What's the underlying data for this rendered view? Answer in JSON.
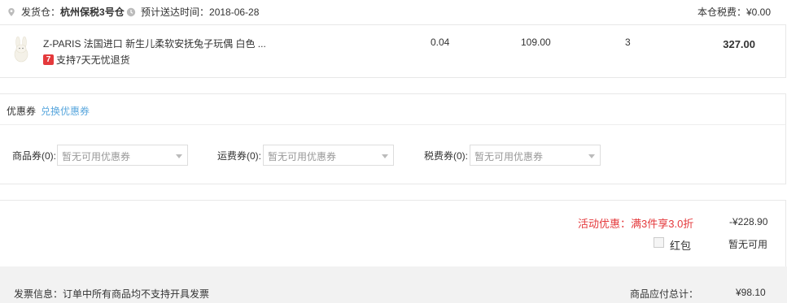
{
  "warehouse": {
    "label": "发货仓：",
    "name": "杭州保税3号仓",
    "eta_label": "预计送达时间：",
    "eta_date": "2018-06-28",
    "tax_label": "本仓税费：",
    "tax_value": "¥0.00"
  },
  "product": {
    "name": "Z-PARIS 法国进口 新生儿柔软安抚兔子玩偶 白色 ...",
    "tag_badge": "7",
    "tag_text": "支持7天无忧退货",
    "weight": "0.04",
    "price": "109.00",
    "quantity": "3",
    "subtotal": "327.00"
  },
  "coupons": {
    "title": "优惠券",
    "exchange_link": "兑换优惠券",
    "product_label": "商品券(0):",
    "product_placeholder": "暂无可用优惠券",
    "shipping_label": "运费券(0):",
    "shipping_placeholder": "暂无可用优惠券",
    "tax_label": "税费券(0):",
    "tax_placeholder": "暂无可用优惠券"
  },
  "discount": {
    "activity_text": "活动优惠：满3件享3.0折",
    "activity_amount": "-¥228.90",
    "red_packet_label": "红包",
    "red_packet_status": "暂无可用"
  },
  "footer": {
    "invoice_text": "发票信息：订单中所有商品均不支持开具发票",
    "payable_label": "商品应付总计：",
    "payable_amount": "¥98.10"
  },
  "colors": {
    "accent_red": "#e4393c",
    "link_blue": "#5aa7dd",
    "footer_bg": "#f2f2f2"
  }
}
